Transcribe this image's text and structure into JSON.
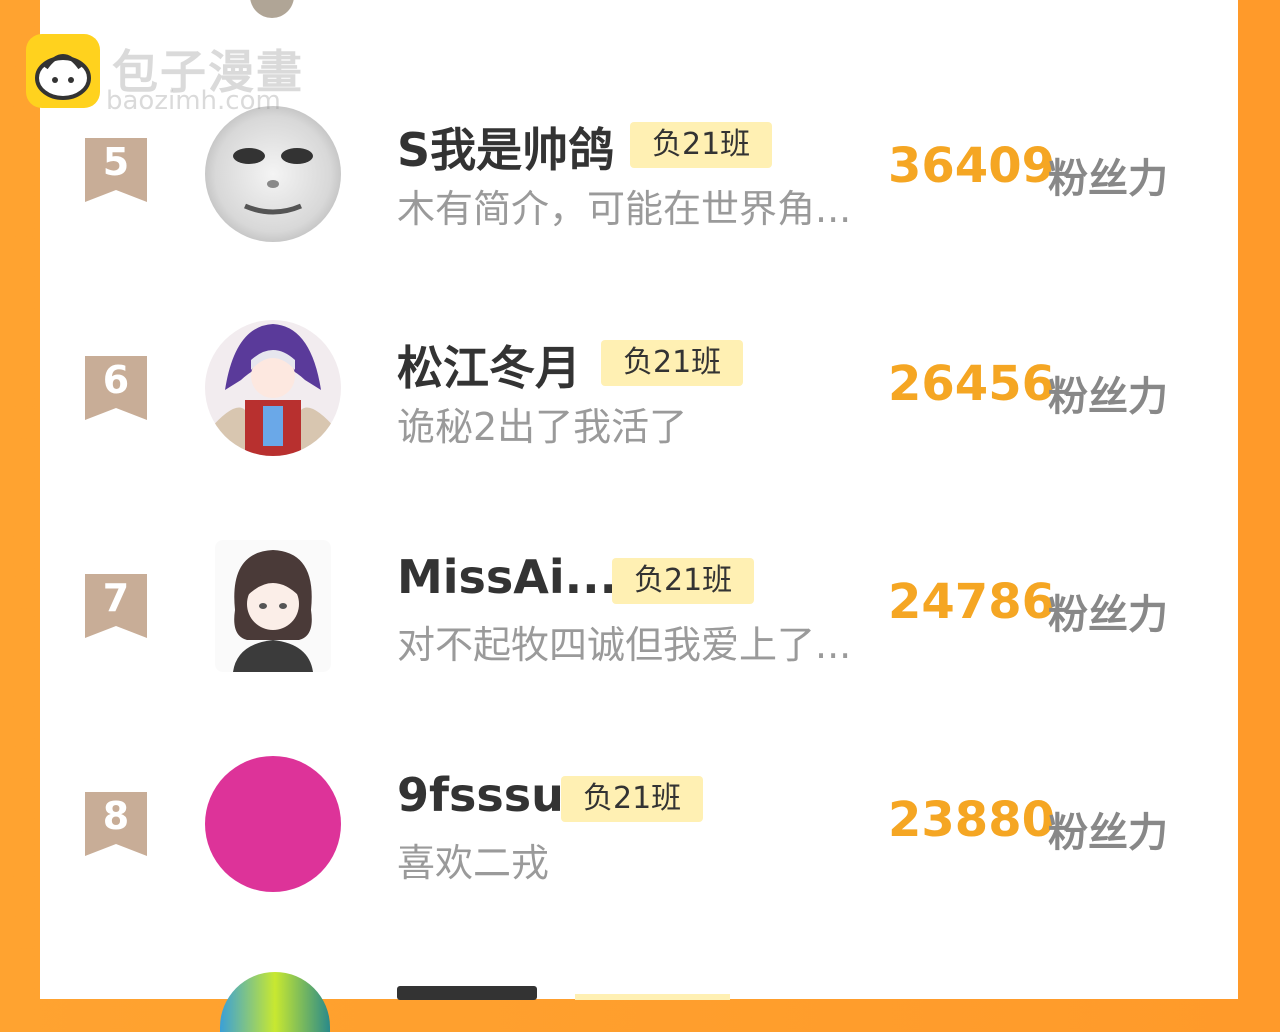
{
  "watermark": {
    "name": "包子漫畫",
    "url": "baozimh.com"
  },
  "score_label": "粉丝力",
  "rows": [
    {
      "rank": "5",
      "name": "S我是帅鸽",
      "badge": "负21班",
      "intro": "木有简介，可能在世界角...",
      "score": "36409",
      "avatar": "meme-face-avatar"
    },
    {
      "rank": "6",
      "name": "松江冬月",
      "badge": "负21班",
      "intro": "诡秘2出了我活了",
      "score": "26456",
      "avatar": "anime-girl-hooded-avatar"
    },
    {
      "rank": "7",
      "name": "MissAi...",
      "badge": "负21班",
      "intro": "对不起牧四诚但我爱上了...",
      "score": "24786",
      "avatar": "anime-girl-sketch-avatar"
    },
    {
      "rank": "8",
      "name": "9fsssu",
      "badge": "负21班",
      "intro": "喜欢二戎",
      "score": "23880",
      "avatar": "magenta-circle-avatar"
    }
  ],
  "colors": {
    "accent": "#f5a623",
    "badge_bg": "#fff0b3",
    "frame": "#ffa330",
    "rank_ribbon": "#c8ad97",
    "avatar_magenta": "#dd3399"
  }
}
